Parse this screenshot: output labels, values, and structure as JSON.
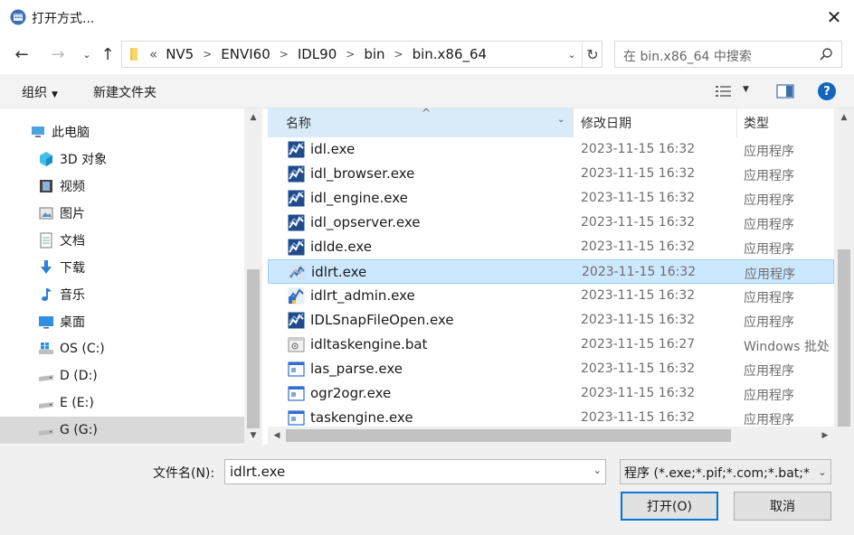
{
  "window": {
    "title": "打开方式..."
  },
  "nav": {
    "breadcrumb_lead": "«",
    "breadcrumbs": [
      "NV5",
      "ENVI60",
      "IDL90",
      "bin",
      "bin.x86_64"
    ],
    "search_placeholder": "在 bin.x86_64 中搜索"
  },
  "toolbar": {
    "organize": "组织",
    "new_folder": "新建文件夹"
  },
  "sidebar": {
    "items": [
      {
        "label": "此电脑",
        "icon": "computer-icon"
      },
      {
        "label": "3D 对象",
        "icon": "3d-objects-icon"
      },
      {
        "label": "视频",
        "icon": "video-icon"
      },
      {
        "label": "图片",
        "icon": "pictures-icon"
      },
      {
        "label": "文档",
        "icon": "documents-icon"
      },
      {
        "label": "下载",
        "icon": "download-icon"
      },
      {
        "label": "音乐",
        "icon": "music-icon"
      },
      {
        "label": "桌面",
        "icon": "desktop-icon"
      },
      {
        "label": "OS (C:)",
        "icon": "windows-drive-icon"
      },
      {
        "label": "D (D:)",
        "icon": "drive-icon"
      },
      {
        "label": "E (E:)",
        "icon": "drive-icon"
      },
      {
        "label": "G (G:)",
        "icon": "drive-icon"
      }
    ],
    "selected_index": 11
  },
  "columns": {
    "name": "名称",
    "date": "修改日期",
    "type": "类型"
  },
  "files": [
    {
      "name": "idl.exe",
      "date": "2023-11-15 16:32",
      "type": "应用程序",
      "icon": "idl-exe-icon"
    },
    {
      "name": "idl_browser.exe",
      "date": "2023-11-15 16:32",
      "type": "应用程序",
      "icon": "idl-exe-icon"
    },
    {
      "name": "idl_engine.exe",
      "date": "2023-11-15 16:32",
      "type": "应用程序",
      "icon": "idl-exe-icon"
    },
    {
      "name": "idl_opserver.exe",
      "date": "2023-11-15 16:32",
      "type": "应用程序",
      "icon": "idl-exe-icon"
    },
    {
      "name": "idlde.exe",
      "date": "2023-11-15 16:32",
      "type": "应用程序",
      "icon": "idl-exe-icon"
    },
    {
      "name": "idlrt.exe",
      "date": "2023-11-15 16:32",
      "type": "应用程序",
      "icon": "idlrt-exe-icon"
    },
    {
      "name": "idlrt_admin.exe",
      "date": "2023-11-15 16:32",
      "type": "应用程序",
      "icon": "idlrt-admin-icon"
    },
    {
      "name": "IDLSnapFileOpen.exe",
      "date": "2023-11-15 16:32",
      "type": "应用程序",
      "icon": "idl-exe-icon"
    },
    {
      "name": "idltaskengine.bat",
      "date": "2023-11-15 16:27",
      "type": "Windows 批处",
      "icon": "bat-file-icon"
    },
    {
      "name": "las_parse.exe",
      "date": "2023-11-15 16:32",
      "type": "应用程序",
      "icon": "generic-exe-icon"
    },
    {
      "name": "ogr2ogr.exe",
      "date": "2023-11-15 16:32",
      "type": "应用程序",
      "icon": "generic-exe-icon"
    },
    {
      "name": "taskengine.exe",
      "date": "2023-11-15 16:32",
      "type": "应用程序",
      "icon": "generic-exe-icon"
    }
  ],
  "selected_file_index": 5,
  "footer": {
    "filename_label": "文件名(N):",
    "filename_value": "idlrt.exe",
    "filetype_value": "程序 (*.exe;*.pif;*.com;*.bat;*",
    "open_label": "打开(O)",
    "cancel_label": "取消"
  },
  "colors": {
    "accent": "#0078d7",
    "selection": "#cce8ff",
    "header_sorted": "#d9ebf9",
    "help": "#1565c0"
  }
}
